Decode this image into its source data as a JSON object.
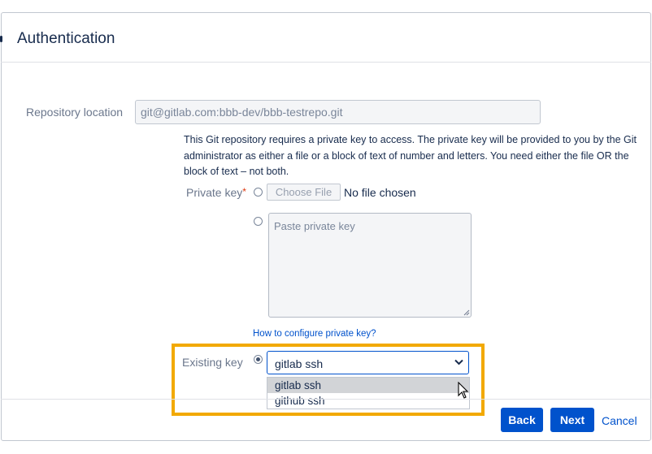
{
  "dialog": {
    "title": "Authentication"
  },
  "repository": {
    "label": "Repository location",
    "value": "git@gitlab.com:bbb-dev/bbb-testrepo.git"
  },
  "help_text": "This Git repository requires a private key to access. The private key will be provided to you by the Git administrator as either a file or a block of text of number and letters. You need either the file OR the block of text – not both.",
  "private_key": {
    "label": "Private key",
    "required_marker": "*",
    "choose_file_label": "Choose File",
    "no_file_text": "No file chosen",
    "paste_placeholder": "Paste private key",
    "help_link": "How to configure private key?"
  },
  "existing_key": {
    "label": "Existing key",
    "selected": "gitlab ssh",
    "options": [
      "gitlab ssh",
      "github ssh"
    ],
    "highlight_color": "#f2a900"
  },
  "footer": {
    "back_label": "Back",
    "next_label": "Next",
    "cancel_label": "Cancel"
  },
  "colors": {
    "primary": "#0052cc",
    "text": "#172b4d",
    "muted": "#6b778c"
  }
}
